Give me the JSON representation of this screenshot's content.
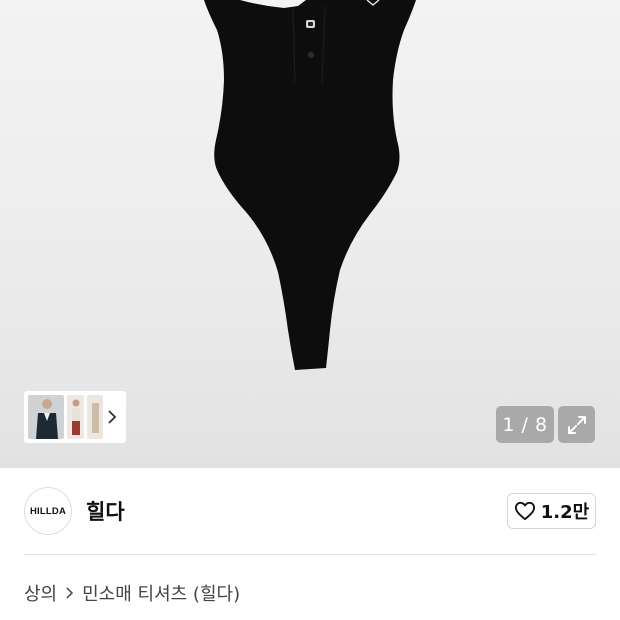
{
  "gallery": {
    "counter": "1 / 8",
    "thumbnails": [
      "thumbnail-1",
      "thumbnail-2",
      "thumbnail-3"
    ],
    "thumbnail_more_icon": "chevron-right-icon",
    "expand_icon": "expand-icon"
  },
  "brand": {
    "logo_text": "HILLDA",
    "name": "힐다",
    "likes": "1.2만",
    "like_icon": "heart-outline-icon"
  },
  "breadcrumb": {
    "category": "상의",
    "separator_icon": "chevron-right-icon",
    "title": "민소매 티셔츠 (힐다)"
  },
  "colors": {
    "garment": "#0d0d0d",
    "overlay_button": "#a9a9a9",
    "text": "#111111"
  }
}
